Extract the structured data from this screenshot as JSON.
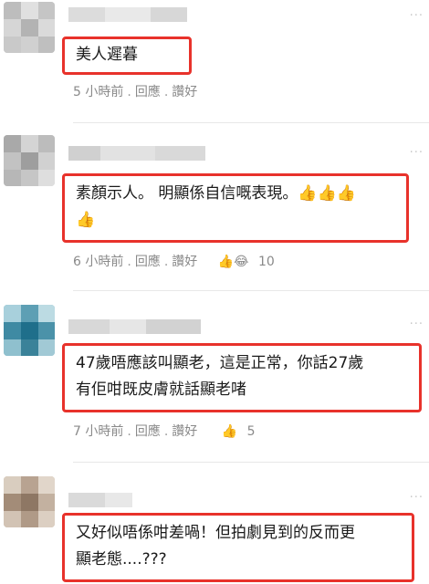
{
  "comments": [
    {
      "text": "美人遲暮",
      "time": "5 小時前",
      "reply": "回應",
      "like": "讚好",
      "reaction_count": "",
      "more": "···"
    },
    {
      "text_line1": "素顏示人。 明顯係自信嘅表現。👍👍👍",
      "text_line2": "👍",
      "time": "6 小時前",
      "reply": "回應",
      "like": "讚好",
      "reactions": "👍😂",
      "reaction_count": "10",
      "more": "···"
    },
    {
      "text_line1": "47歲唔應該叫顯老，這是正常，你話27歲",
      "text_line2": "有佢咁既皮膚就話顯老啫",
      "time": "7 小時前",
      "reply": "回應",
      "like": "讚好",
      "reactions": "👍",
      "reaction_count": "5",
      "more": "···"
    },
    {
      "text_line1": "又好似唔係咁差喎！但拍劇見到的反而更",
      "text_line2": "顯老態....???",
      "more": "···"
    }
  ],
  "colors": {
    "highlight_border": "#e8322b",
    "meta_text": "#8a8a8a"
  }
}
